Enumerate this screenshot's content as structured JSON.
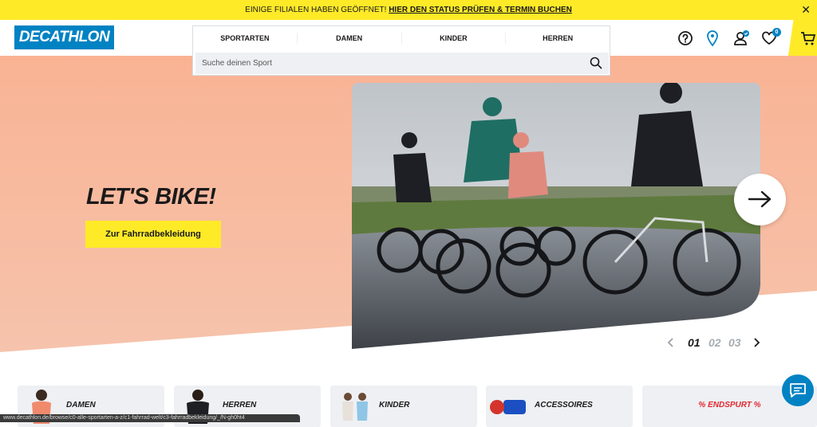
{
  "banner": {
    "text": "EINIGE FILIALEN HABEN GEÖFFNET!",
    "link": "HIER DEN STATUS PRÜFEN & TERMIN BUCHEN",
    "close": "✕"
  },
  "header": {
    "logo": "DECATHLON",
    "nav": [
      "SPORTARTEN",
      "DAMEN",
      "KINDER",
      "HERREN"
    ],
    "search_placeholder": "Suche deinen Sport",
    "wishlist_count": "0",
    "icons": [
      "help-icon",
      "location-icon",
      "account-icon",
      "heart-icon",
      "cart-icon"
    ]
  },
  "hero": {
    "title": "LET'S BIKE!",
    "cta": "Zur Fahrradbekleidung",
    "pager": [
      "01",
      "02",
      "03"
    ],
    "active_page": "01"
  },
  "categories": [
    {
      "label": "DAMEN"
    },
    {
      "label": "HERREN"
    },
    {
      "label": "KINDER"
    },
    {
      "label": "ACCESSOIRES"
    },
    {
      "label": "% ENDSPURT %"
    }
  ],
  "statusbar": {
    "url": "www.decathlon.de/browse/c0-alle-sportarten-a-z/c1-fahrrad-welt/c3-fahrradbekleidung/_/N-gh0ht4"
  },
  "colors": {
    "brand_blue": "#0082c3",
    "accent_yellow": "#ffea28",
    "hero_peach": "#f7b596",
    "sale_red": "#e3262f"
  }
}
